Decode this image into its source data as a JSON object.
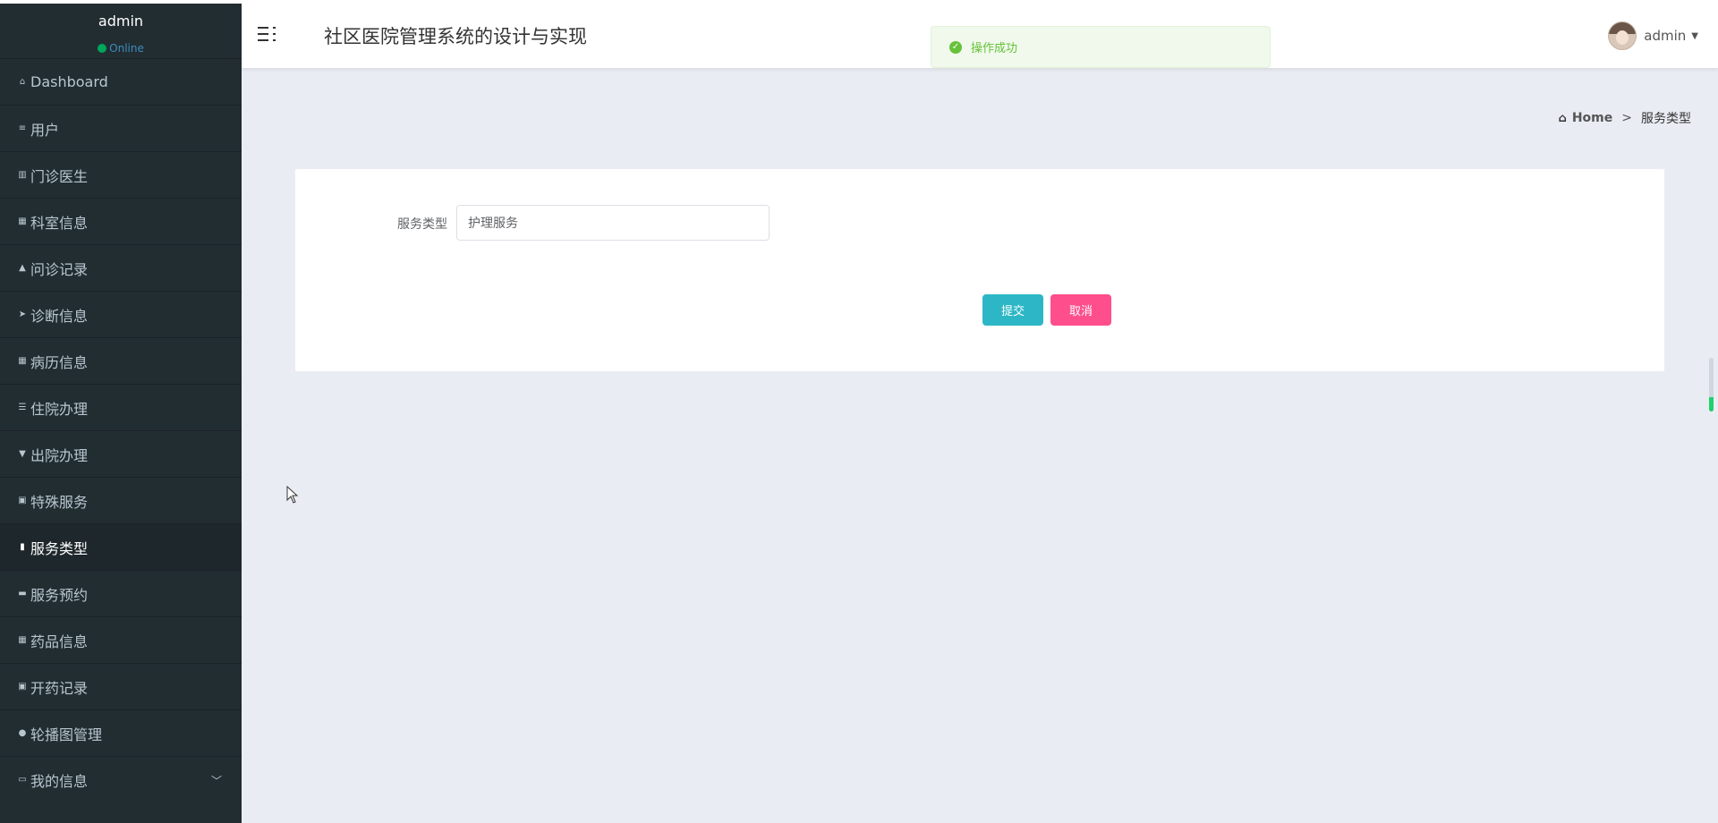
{
  "app": {
    "title": "社区医院管理系统的设计与实现"
  },
  "sidebar": {
    "user": {
      "name": "admin",
      "status": "Online"
    },
    "items": [
      {
        "label": "Dashboard",
        "icon": "home-outline-icon"
      },
      {
        "label": "用户",
        "icon": "sliders-icon"
      },
      {
        "label": "门诊医生",
        "icon": "books-icon"
      },
      {
        "label": "科室信息",
        "icon": "grid-icon"
      },
      {
        "label": "问诊记录",
        "icon": "thumbs-up-icon"
      },
      {
        "label": "诊断信息",
        "icon": "send-icon"
      },
      {
        "label": "病历信息",
        "icon": "dashboard-icon"
      },
      {
        "label": "住院办理",
        "icon": "list-icon"
      },
      {
        "label": "出院办理",
        "icon": "pin-icon"
      },
      {
        "label": "特殊服务",
        "icon": "clipboard-icon"
      },
      {
        "label": "服务类型",
        "icon": "bar-chart-icon",
        "active": true
      },
      {
        "label": "服务预约",
        "icon": "monitor-icon"
      },
      {
        "label": "药品信息",
        "icon": "dashboard-icon"
      },
      {
        "label": "开药记录",
        "icon": "clipboard-list-icon"
      },
      {
        "label": "轮播图管理",
        "icon": "user-icon"
      },
      {
        "label": "我的信息",
        "icon": "id-card-icon",
        "has_submenu": true
      }
    ]
  },
  "header": {
    "user_name": "admin"
  },
  "toast": {
    "message": "操作成功",
    "type": "success"
  },
  "breadcrumb": {
    "home": "Home",
    "separator": ">",
    "current": "服务类型"
  },
  "form": {
    "field_label": "服务类型",
    "field_value": "护理服务",
    "submit_label": "提交",
    "cancel_label": "取消"
  },
  "colors": {
    "sidebar_bg": "#222d32",
    "content_bg": "#e9edf3",
    "submit_button": "#2db7c6",
    "cancel_button": "#ff4e8c",
    "success": "#67c23a"
  }
}
